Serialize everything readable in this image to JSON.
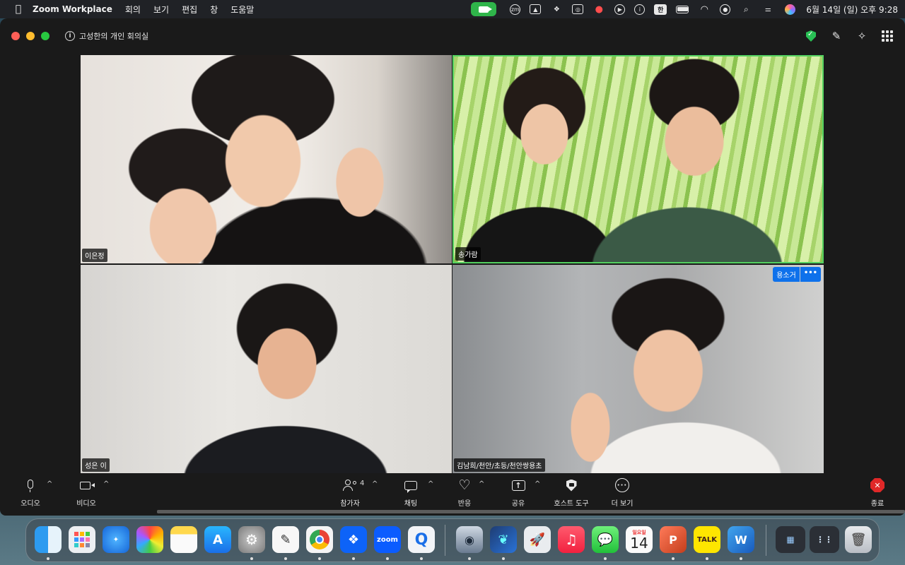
{
  "menubar": {
    "app_name": "Zoom Workplace",
    "menus": [
      "회의",
      "보기",
      "편집",
      "창",
      "도움말"
    ],
    "status_icons": [
      "zoom-active-icon",
      "zm-icon",
      "drive-icon",
      "dropbox-icon",
      "app-icon",
      "record-icon",
      "play-icon",
      "accessibility-icon",
      "input-han-icon",
      "battery-icon",
      "wifi-icon",
      "user-icon",
      "search-icon",
      "control-center-icon",
      "siri-icon"
    ],
    "input_method": "한",
    "zm_badge": "zm",
    "clock": "6월 14일 (일) 오후 9:28"
  },
  "window": {
    "meeting_title": "고성한의 개인 회의실",
    "colors": {
      "active_speaker_border": "#53d160",
      "security_green": "#29c055",
      "end_red": "#e02828",
      "badge_blue": "#0e71eb"
    }
  },
  "participants": [
    {
      "name": "이은정"
    },
    {
      "name": "송가람",
      "active_speaker": true
    },
    {
      "name": "성은 이"
    },
    {
      "name": "김남희/천안/초등/천안쌍용초"
    }
  ],
  "active_speaker_badge": {
    "name": "용소거",
    "more": "•••"
  },
  "toolbar": {
    "audio": "오디오",
    "video": "비디오",
    "participants": "참가자",
    "participants_count": "4",
    "chat": "채팅",
    "reactions": "반응",
    "share": "공유",
    "host_tools": "호스트 도구",
    "more": "더 보기",
    "end": "종료",
    "caret": "^"
  },
  "dock": {
    "items": [
      {
        "name": "finder"
      },
      {
        "name": "launchpad"
      },
      {
        "name": "safari"
      },
      {
        "name": "photos"
      },
      {
        "name": "notes"
      },
      {
        "name": "app-store"
      },
      {
        "name": "system-settings"
      },
      {
        "name": "freeform"
      },
      {
        "name": "chrome"
      },
      {
        "name": "dropbox"
      },
      {
        "name": "zoom",
        "label": "zoom"
      },
      {
        "name": "quicktime"
      },
      {
        "name": "bartender"
      },
      {
        "name": "copilot"
      },
      {
        "name": "rocket"
      },
      {
        "name": "music"
      },
      {
        "name": "messages"
      },
      {
        "name": "calendar",
        "weekday": "일요일",
        "day": "14"
      },
      {
        "name": "powerpoint"
      },
      {
        "name": "kakaotalk",
        "label": "TALK"
      },
      {
        "name": "word"
      },
      {
        "name": "downloads"
      },
      {
        "name": "screens"
      },
      {
        "name": "trash"
      }
    ]
  }
}
